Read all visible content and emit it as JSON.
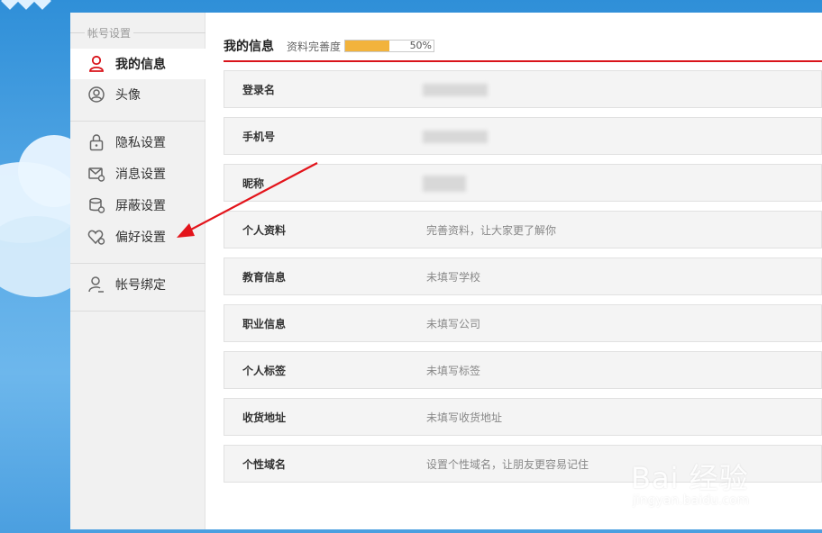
{
  "sidebar": {
    "section_title": "帐号设置",
    "items": [
      {
        "label": "我的信息",
        "icon": "user-icon",
        "active": true
      },
      {
        "label": "头像",
        "icon": "avatar-icon",
        "active": false
      },
      {
        "label": "隐私设置",
        "icon": "lock-icon",
        "active": false
      },
      {
        "label": "消息设置",
        "icon": "mail-settings-icon",
        "active": false
      },
      {
        "label": "屏蔽设置",
        "icon": "block-settings-icon",
        "active": false
      },
      {
        "label": "偏好设置",
        "icon": "heart-settings-icon",
        "active": false
      },
      {
        "label": "帐号绑定",
        "icon": "account-bind-icon",
        "active": false
      }
    ]
  },
  "main": {
    "title": "我的信息",
    "completeness_label": "资料完善度",
    "completeness_percent": 50,
    "completeness_text": "50%",
    "rows": [
      {
        "label": "登录名",
        "value": "",
        "blurred": true
      },
      {
        "label": "手机号",
        "value": "",
        "blurred": true
      },
      {
        "label": "昵称",
        "value": "",
        "blurred": true
      },
      {
        "label": "个人资料",
        "value": "完善资料，让大家更了解你",
        "blurred": false
      },
      {
        "label": "教育信息",
        "value": "未填写学校",
        "blurred": false
      },
      {
        "label": "职业信息",
        "value": "未填写公司",
        "blurred": false
      },
      {
        "label": "个人标签",
        "value": "未填写标签",
        "blurred": false
      },
      {
        "label": "收货地址",
        "value": "未填写收货地址",
        "blurred": false
      },
      {
        "label": "个性域名",
        "value": "设置个性域名，让朋友更容易记住",
        "blurred": false
      }
    ]
  },
  "colors": {
    "accent_red": "#d9141b",
    "progress_fill": "#f2b33c",
    "sidebar_bg": "#f1f1f1",
    "row_bg": "#f4f4f4"
  },
  "watermark": {
    "main": "Bai 经验",
    "sub": "jingyan.baidu.com"
  }
}
